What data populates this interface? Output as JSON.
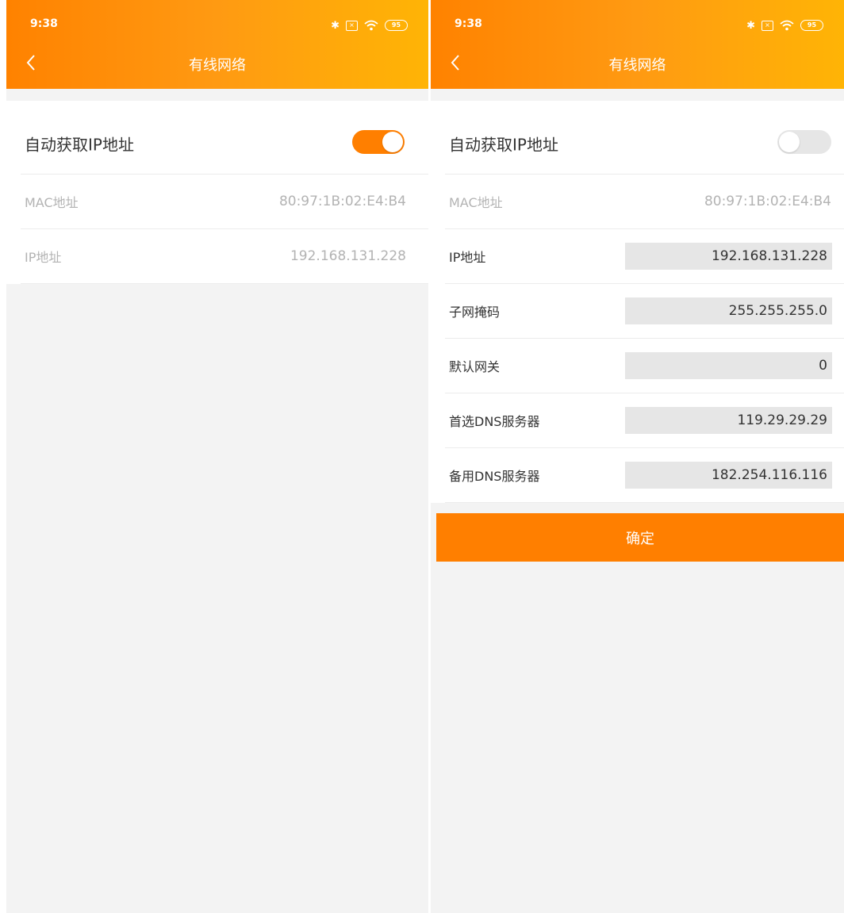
{
  "status_bar": {
    "time": "9:38",
    "battery": "95",
    "sim": "×"
  },
  "appbar": {
    "title": "有线网络"
  },
  "colors": {
    "accent": "#ff7f00",
    "gradient_end": "#ffb405",
    "field_bg": "#e6e6e6",
    "page_bg": "#f3f3f3"
  },
  "icons": [
    "back-chevron",
    "bluetooth",
    "sim-card",
    "wifi",
    "battery"
  ],
  "left": {
    "auto_ip": {
      "label": "自动获取IP地址",
      "enabled": true
    },
    "mac": {
      "label": "MAC地址",
      "value": "80:97:1B:02:E4:B4"
    },
    "ip": {
      "label": "IP地址",
      "value": "192.168.131.228"
    }
  },
  "right": {
    "auto_ip": {
      "label": "自动获取IP地址",
      "enabled": false
    },
    "mac": {
      "label": "MAC地址",
      "value": "80:97:1B:02:E4:B4"
    },
    "ip": {
      "label": "IP地址",
      "value": "192.168.131.228"
    },
    "subnet": {
      "label": "子网掩码",
      "value": "255.255.255.0"
    },
    "gateway": {
      "label": "默认网关",
      "value": "0"
    },
    "dns_primary": {
      "label": "首选DNS服务器",
      "value": "119.29.29.29"
    },
    "dns_secondary": {
      "label": "备用DNS服务器",
      "value": "182.254.116.116"
    },
    "confirm_label": "确定"
  }
}
